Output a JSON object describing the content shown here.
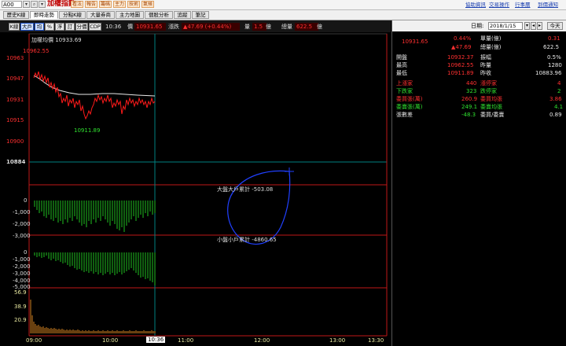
{
  "topbar": {
    "code": "A00",
    "title": "加權指數",
    "menu_tabs": [
      "看法",
      "報告",
      "籌碼",
      "主力",
      "技術",
      "氣候"
    ],
    "right_links": [
      "協助資訊",
      "交易操作",
      "行事曆",
      "到價通知"
    ]
  },
  "tabs": [
    "歷史K線",
    "即時走勢",
    "分點K線",
    "大量券商",
    "主力地圖",
    "個股分析",
    "追蹤",
    "筆記"
  ],
  "toolbar": {
    "buttons": [
      "K線",
      "大戶",
      "均",
      "%",
      "浮",
      "訂",
      "分價",
      "CDP"
    ],
    "time": "10:36",
    "price_label": "價",
    "price_value": "10931.65",
    "change_label": "漲跌",
    "change_value": "▲47.69 (+0.44%)",
    "volume_label": "量",
    "volume_value": "1.5",
    "volume_unit": "億",
    "total_label": "總量",
    "total_value": "622.5",
    "total_unit": "億"
  },
  "chart": {
    "legend": "加權均價 10933.69",
    "high_annotation": "10962.55",
    "low_annotation": "10911.89",
    "price_axis": [
      "10963",
      "10947",
      "10931",
      "10915",
      "10900",
      "10884"
    ],
    "big_label": "大盤大戶累計 -503.08",
    "big_axis": [
      "0",
      "-1,000",
      "-2,000",
      "-3,000"
    ],
    "small_label": "小盤小戶累計 -4860.65",
    "small_axis": [
      "0",
      "-1,000",
      "-2,000",
      "-3,000",
      "-4,000",
      "-5,000"
    ],
    "vol_axis": [
      "56.9",
      "38.9",
      "20.9"
    ],
    "time_axis": [
      "09:00",
      "10:00",
      "11:00",
      "12:00",
      "13:00",
      "13:30"
    ],
    "current_time": "10:36"
  },
  "right_panel": {
    "date_label": "日期:",
    "date_value": "2018/1/15",
    "today_label": "今天",
    "quote_price": "10931.65",
    "quote_pct": "0.44%",
    "quote_change": "▲47.69",
    "unit_vol_label": "單量(億)",
    "unit_vol_value": "0.31",
    "total_vol_label": "總量(億)",
    "total_vol_value": "622.5",
    "rows": [
      {
        "l1": "開盤",
        "v1": "10932.37",
        "l2": "振幅",
        "v2": "0.5%"
      },
      {
        "l1": "最高",
        "v1": "10962.55",
        "l2": "昨量",
        "v2": "1280"
      },
      {
        "l1": "最低",
        "v1": "10911.89",
        "l2": "昨收",
        "v2": "10883.96"
      }
    ],
    "rows2": [
      {
        "l1": "上漲家",
        "v1": "440",
        "l2": "漲停家",
        "v2": "4"
      },
      {
        "l1": "下跌家",
        "v1": "323",
        "l2": "跌停家",
        "v2": "2"
      },
      {
        "l1": "委買張(萬)",
        "v1": "260.9",
        "l2": "委買均張",
        "v2": "3.86"
      },
      {
        "l1": "委賣張(萬)",
        "v1": "249.1",
        "l2": "委賣均張",
        "v2": "4.1"
      },
      {
        "l1": "張數差",
        "v1": "-48.3",
        "l2": "委買/委賣",
        "v2": "0.89"
      }
    ]
  },
  "colors": {
    "up": "#ff3030",
    "down": "#30e030",
    "price_line": "#ff1a1a",
    "avg_line": "#e8e8e8",
    "ref_line": "#008080",
    "annotation": "#2040ff",
    "volume_bar": "#d08020"
  }
}
